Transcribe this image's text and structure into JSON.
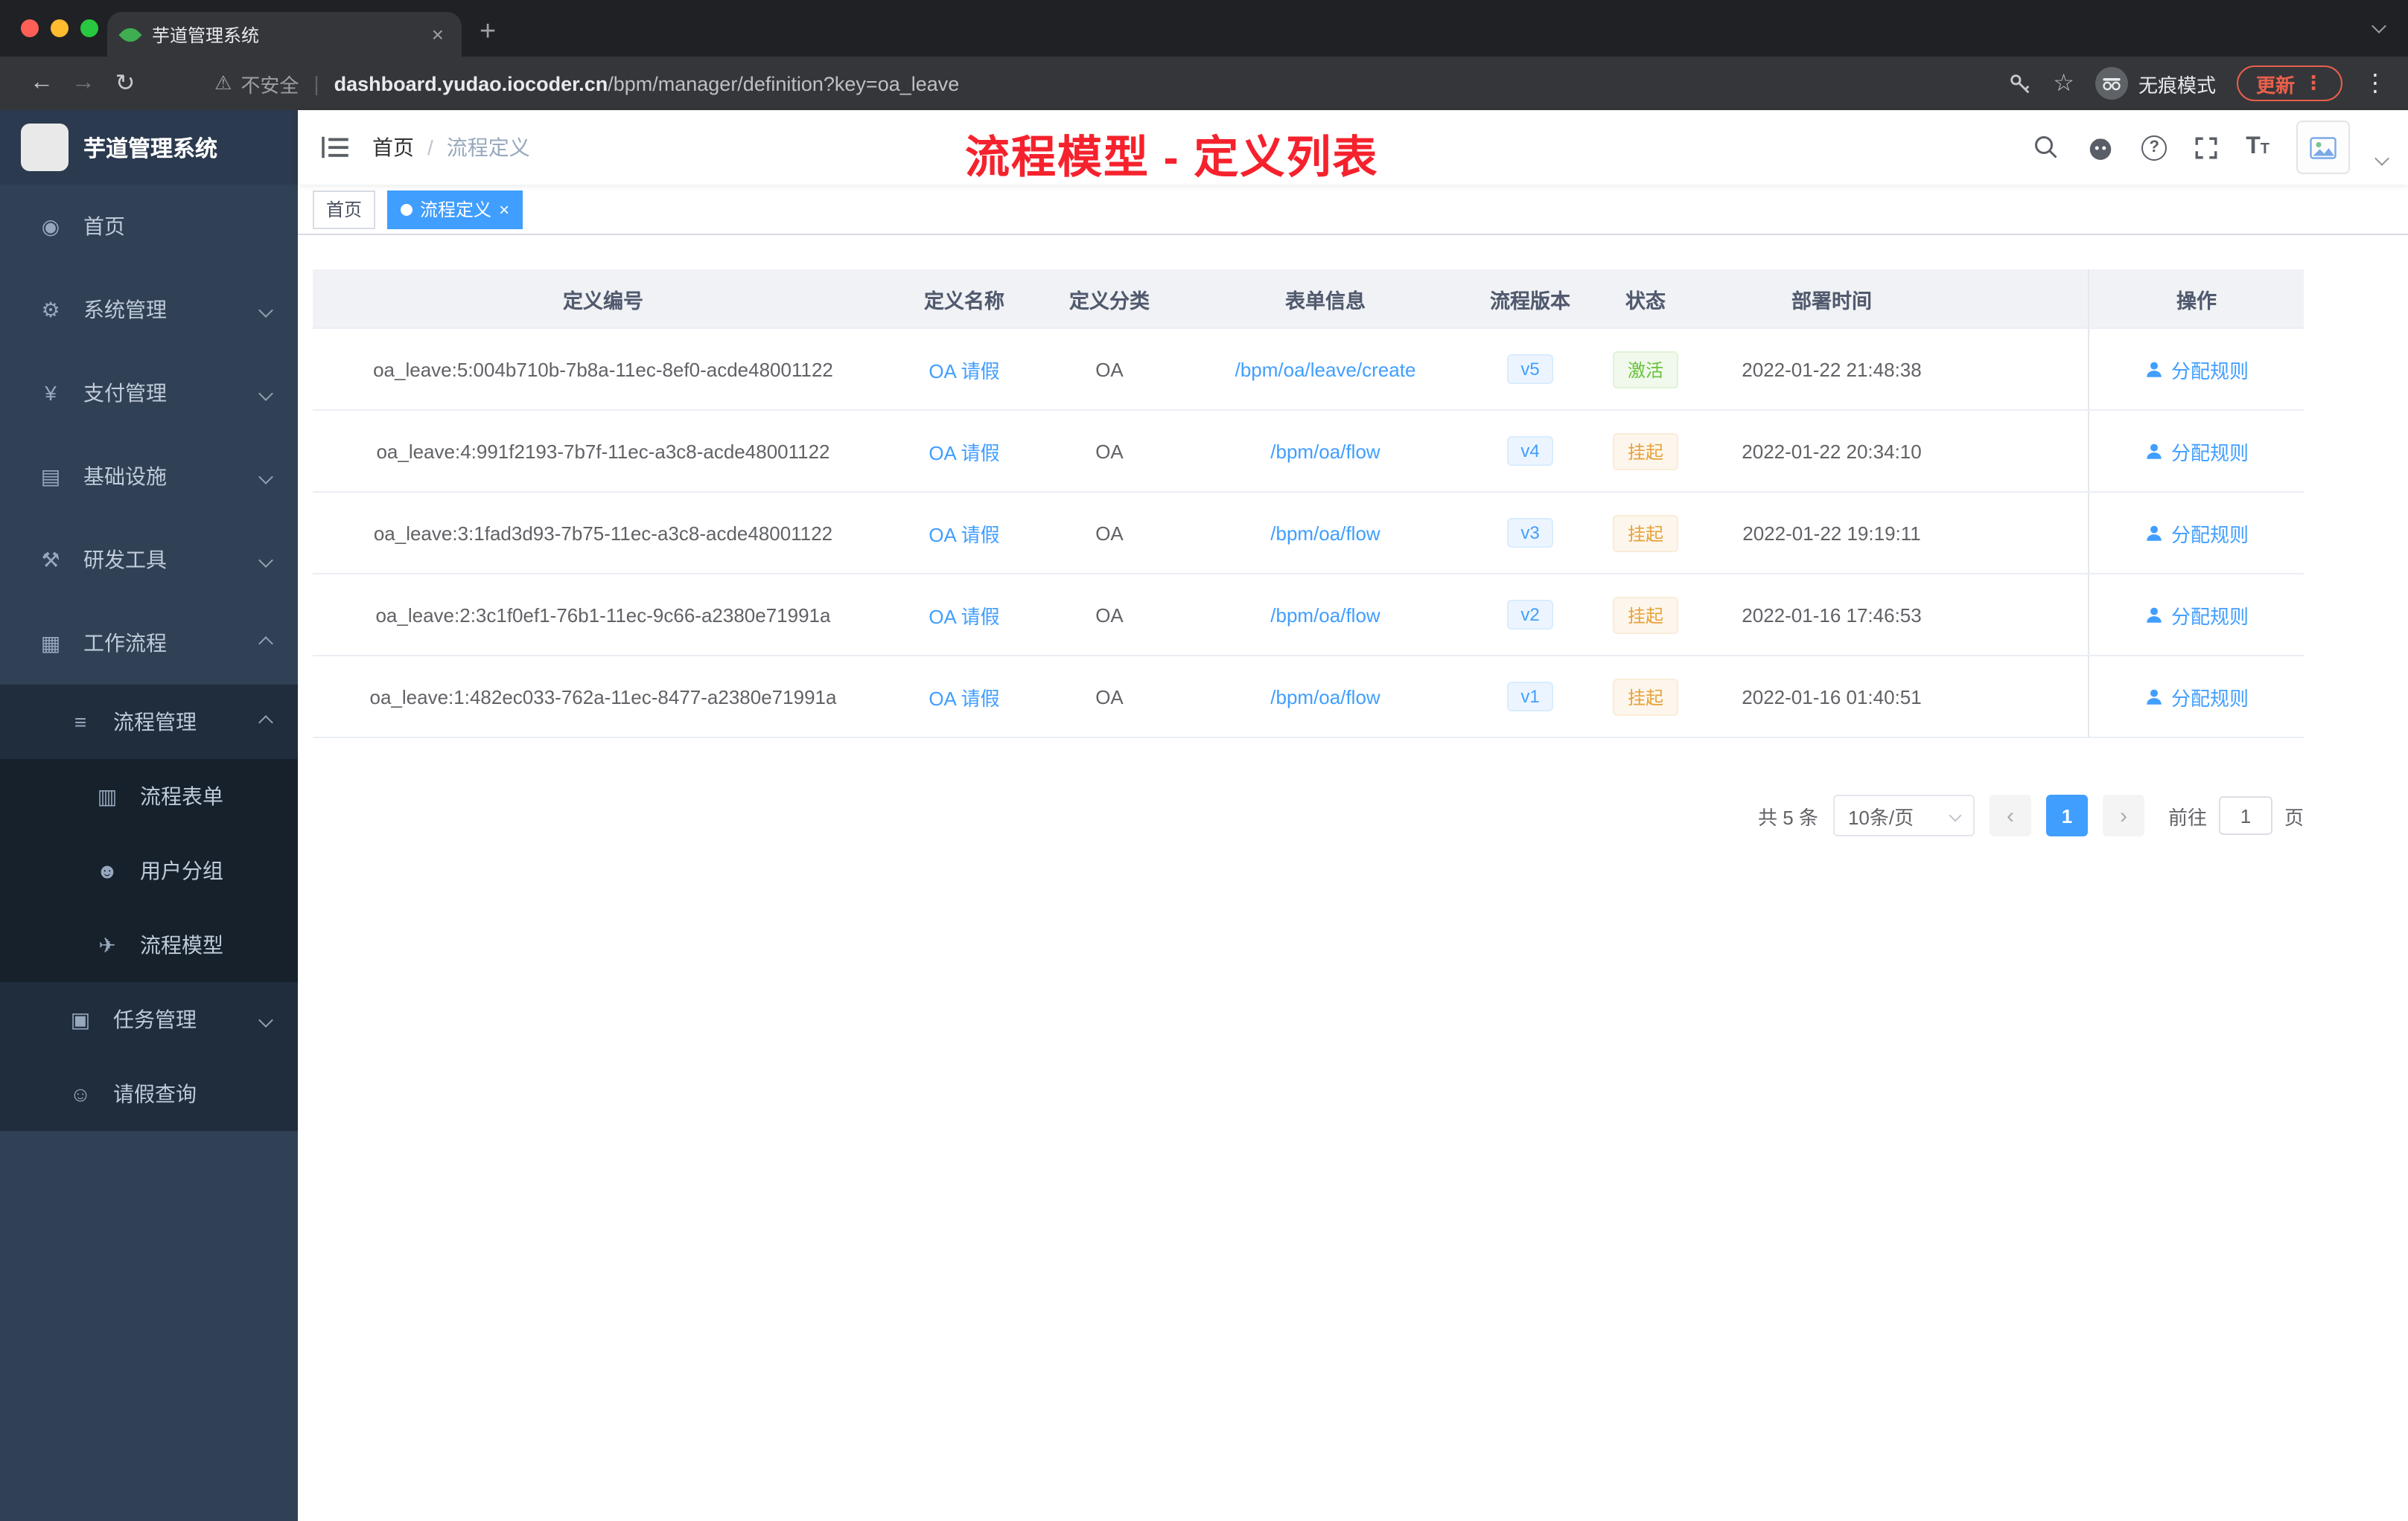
{
  "browser": {
    "tab_title": "芋道管理系统",
    "security_label": "不安全",
    "url_domain": "dashboard.yudao.iocoder.cn",
    "url_path": "/bpm/manager/definition?key=oa_leave",
    "incognito_label": "无痕模式",
    "update_label": "更新"
  },
  "icons": {
    "close": "×",
    "plus": "+",
    "more": "⋮",
    "star": "☆",
    "back": "←",
    "forward": "→",
    "reload": "↻",
    "warning": "⚠",
    "divider": "|",
    "prev": "‹",
    "next": "›",
    "help": "?",
    "font_large": "T",
    "font_small": "T"
  },
  "sidebar": {
    "logo_title": "芋道管理系统",
    "items": [
      {
        "label": "首页",
        "icon": "◉",
        "icon_name": "dashboard-icon"
      },
      {
        "label": "系统管理",
        "icon": "⚙",
        "icon_name": "gear-icon"
      },
      {
        "label": "支付管理",
        "icon": "¥",
        "icon_name": "yen-icon"
      },
      {
        "label": "基础设施",
        "icon": "▤",
        "icon_name": "infrastructure-icon"
      },
      {
        "label": "研发工具",
        "icon": "⚒",
        "icon_name": "tools-icon"
      },
      {
        "label": "工作流程",
        "icon": "▦",
        "icon_name": "workflow-icon"
      },
      {
        "label": "流程管理",
        "icon": "≡",
        "icon_name": "process-list-icon"
      },
      {
        "label": "流程表单",
        "icon": "▥",
        "icon_name": "form-icon"
      },
      {
        "label": "用户分组",
        "icon": "☻",
        "icon_name": "user-group-icon"
      },
      {
        "label": "流程模型",
        "icon": "✈",
        "icon_name": "send-icon"
      },
      {
        "label": "任务管理",
        "icon": "▣",
        "icon_name": "task-icon"
      },
      {
        "label": "请假查询",
        "icon": "☺",
        "icon_name": "person-icon"
      }
    ]
  },
  "header": {
    "breadcrumb_home": "首页",
    "breadcrumb_separator": "/",
    "breadcrumb_current": "流程定义",
    "annotation": "流程模型 - 定义列表"
  },
  "tags": {
    "home": "首页",
    "active": "流程定义"
  },
  "table": {
    "columns": [
      "定义编号",
      "定义名称",
      "定义分类",
      "表单信息",
      "流程版本",
      "状态",
      "部署时间",
      "操作"
    ],
    "rows": [
      {
        "id": "oa_leave:5:004b710b-7b8a-11ec-8ef0-acde48001122",
        "name": "OA 请假",
        "category": "OA",
        "form": "/bpm/oa/leave/create",
        "version": "v5",
        "status": "激活",
        "time": "2022-01-22 21:48:38",
        "action": "分配规则"
      },
      {
        "id": "oa_leave:4:991f2193-7b7f-11ec-a3c8-acde48001122",
        "name": "OA 请假",
        "category": "OA",
        "form": "/bpm/oa/flow",
        "version": "v4",
        "status": "挂起",
        "time": "2022-01-22 20:34:10",
        "action": "分配规则"
      },
      {
        "id": "oa_leave:3:1fad3d93-7b75-11ec-a3c8-acde48001122",
        "name": "OA 请假",
        "category": "OA",
        "form": "/bpm/oa/flow",
        "version": "v3",
        "status": "挂起",
        "time": "2022-01-22 19:19:11",
        "action": "分配规则"
      },
      {
        "id": "oa_leave:2:3c1f0ef1-76b1-11ec-9c66-a2380e71991a",
        "name": "OA 请假",
        "category": "OA",
        "form": "/bpm/oa/flow",
        "version": "v2",
        "status": "挂起",
        "time": "2022-01-16 17:46:53",
        "action": "分配规则"
      },
      {
        "id": "oa_leave:1:482ec033-762a-11ec-8477-a2380e71991a",
        "name": "OA 请假",
        "category": "OA",
        "form": "/bpm/oa/flow",
        "version": "v1",
        "status": "挂起",
        "time": "2022-01-16 01:40:51",
        "action": "分配规则"
      }
    ]
  },
  "pagination": {
    "total": "共 5 条",
    "page_size": "10条/页",
    "current": "1",
    "goto_label": "前往",
    "goto_value": "1",
    "page_unit": "页"
  },
  "colors": {
    "accent": "#409eff",
    "success": "#67c23a",
    "warning": "#e6a23c",
    "annotation_red": "#f5222d",
    "sidebar_bg": "#304156"
  }
}
